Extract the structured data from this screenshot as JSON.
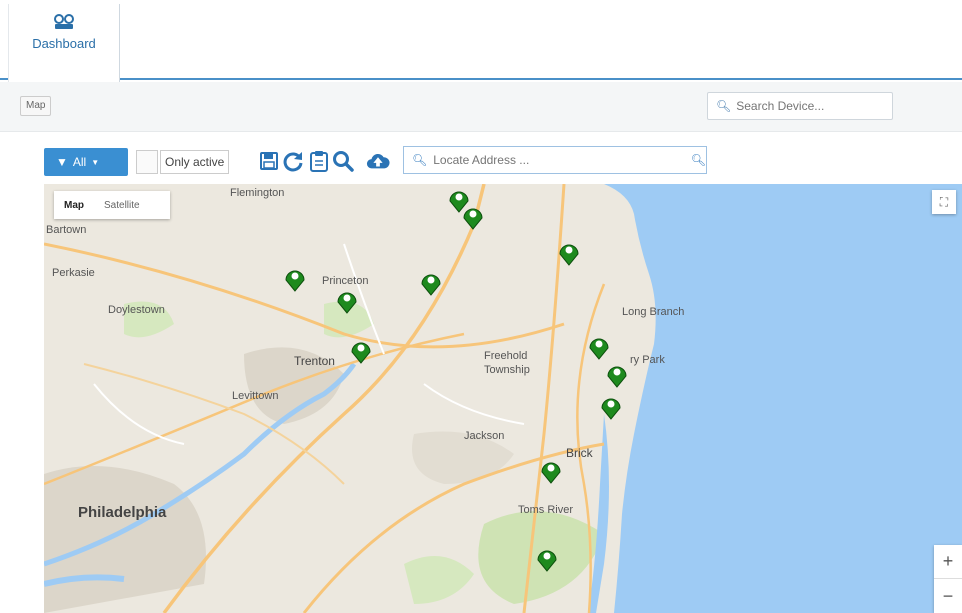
{
  "tabs": {
    "dashboard_label": "Dashboard"
  },
  "toolbar": {
    "map_button": "Map",
    "search_placeholder": "Search Device..."
  },
  "map_tools": {
    "filter_label": "All",
    "only_active_label": "Only active",
    "icons": [
      "save-icon",
      "refresh-icon",
      "clipboard-icon",
      "search-icon",
      "cloud-upload-icon"
    ],
    "locate_placeholder": "Locate Address ..."
  },
  "map": {
    "type_control": {
      "map": "Map",
      "satellite": "Satellite"
    },
    "zoom_in": "+",
    "zoom_out": "−",
    "places": {
      "flemington": "Flemington",
      "bartown": "Bartown",
      "perkasie": "Perkasie",
      "doylestown": "Doylestown",
      "princeton": "Princeton",
      "trenton": "Trenton",
      "levittown": "Levittown",
      "long_branch": "Long Branch",
      "asbury_park": "ry Park",
      "freehold": "Freehold",
      "freehold2": "Township",
      "jackson": "Jackson",
      "brick": "Brick",
      "toms_river": "Toms River",
      "philadelphia": "Philadelphia"
    },
    "colors": {
      "land": "#ece8df",
      "water": "#9ecbf4",
      "marker": "#1e8a1e",
      "highway": "#f7c57a",
      "urban": "#dcd6ca",
      "park": "#cfe3b4"
    }
  }
}
